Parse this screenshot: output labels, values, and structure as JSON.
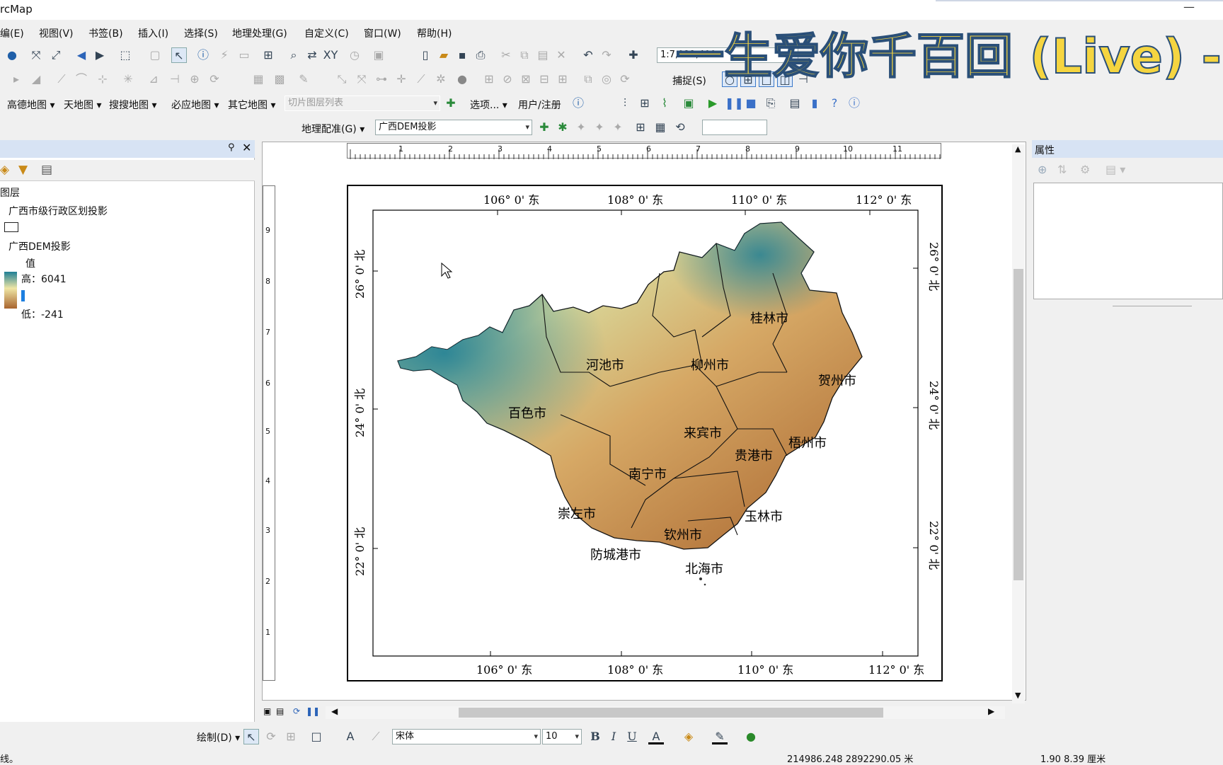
{
  "app": {
    "title": "rcMap",
    "minimize": "—"
  },
  "menu": [
    "编(E)",
    "视图(V)",
    "书签(B)",
    "插入(I)",
    "选择(S)",
    "地理处理(G)",
    "自定义(C)",
    "窗口(W)",
    "帮助(H)"
  ],
  "toolbar": {
    "scale": "1:7,922,400",
    "snapping": "捕捉(S)",
    "online_maps": [
      "高德地图",
      "天地图",
      "搜搜地图",
      "必应地图",
      "其它地图"
    ],
    "tile_layer_placeholder": "切片图层列表",
    "options": "选项...",
    "user_register": "用户/注册",
    "georef": "地理配准(G)",
    "georef_layer": "广西DEM投影"
  },
  "toc": {
    "root": "图层",
    "layers": [
      {
        "name": "广西市级行政区划投影"
      },
      {
        "name": "广西DEM投影",
        "value_label": "值",
        "high": "高：6041",
        "low": "低：-241"
      }
    ]
  },
  "map": {
    "top_lon": [
      "106° 0' 东",
      "108° 0' 东",
      "110° 0' 东",
      "112° 0' 东"
    ],
    "bottom_lon": [
      "106° 0' 东",
      "108° 0' 东",
      "110° 0' 东",
      "112° 0' 东"
    ],
    "lat": [
      "26° 0' 北",
      "24° 0' 北",
      "22° 0' 北"
    ],
    "cities": [
      "桂林市",
      "河池市",
      "柳州市",
      "贺州市",
      "百色市",
      "来宾市",
      "梧州市",
      "贵港市",
      "南宁市",
      "崇左市",
      "玉林市",
      "钦州市",
      "防城港市",
      "北海市"
    ],
    "ruler_top": [
      "1",
      "2",
      "3",
      "4",
      "5",
      "6",
      "7",
      "8",
      "9",
      "10",
      "11"
    ],
    "ruler_left": [
      "9",
      "8",
      "7",
      "6",
      "5",
      "4",
      "3",
      "2",
      "1"
    ]
  },
  "props": {
    "title": "属性"
  },
  "draw": {
    "label": "绘制(D)",
    "font": "宋体",
    "size": "10",
    "bold": "B",
    "italic": "I",
    "underline": "U"
  },
  "status": {
    "left": "线。",
    "coords": "214986.248  2892290.05 米",
    "page": "1.90  8.39 厘米"
  },
  "overlay": {
    "text": "一生爱你千百回 (Live) -"
  },
  "colors": {
    "dem_high": "#1f7f95",
    "dem_mid": "#efe6a4",
    "dem_low": "#a8642e",
    "panel_header": "#d7e3f4"
  }
}
